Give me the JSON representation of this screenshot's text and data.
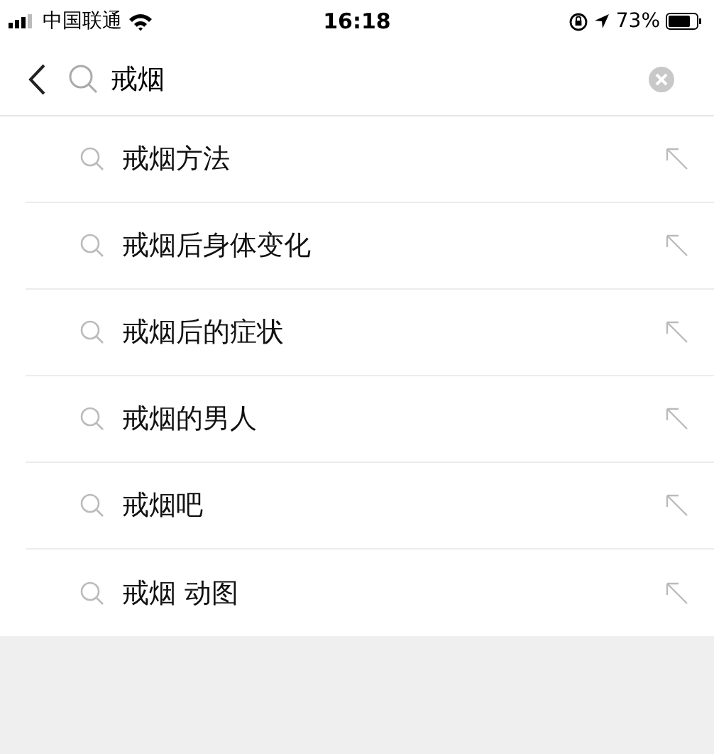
{
  "status_bar": {
    "carrier": "中国联通",
    "time": "16:18",
    "battery": "73%"
  },
  "search": {
    "value": "戒烟"
  },
  "suggestions": [
    {
      "text": "戒烟方法"
    },
    {
      "text": "戒烟后身体变化"
    },
    {
      "text": "戒烟后的症状"
    },
    {
      "text": "戒烟的男人"
    },
    {
      "text": "戒烟吧"
    },
    {
      "text": "戒烟 动图"
    }
  ]
}
